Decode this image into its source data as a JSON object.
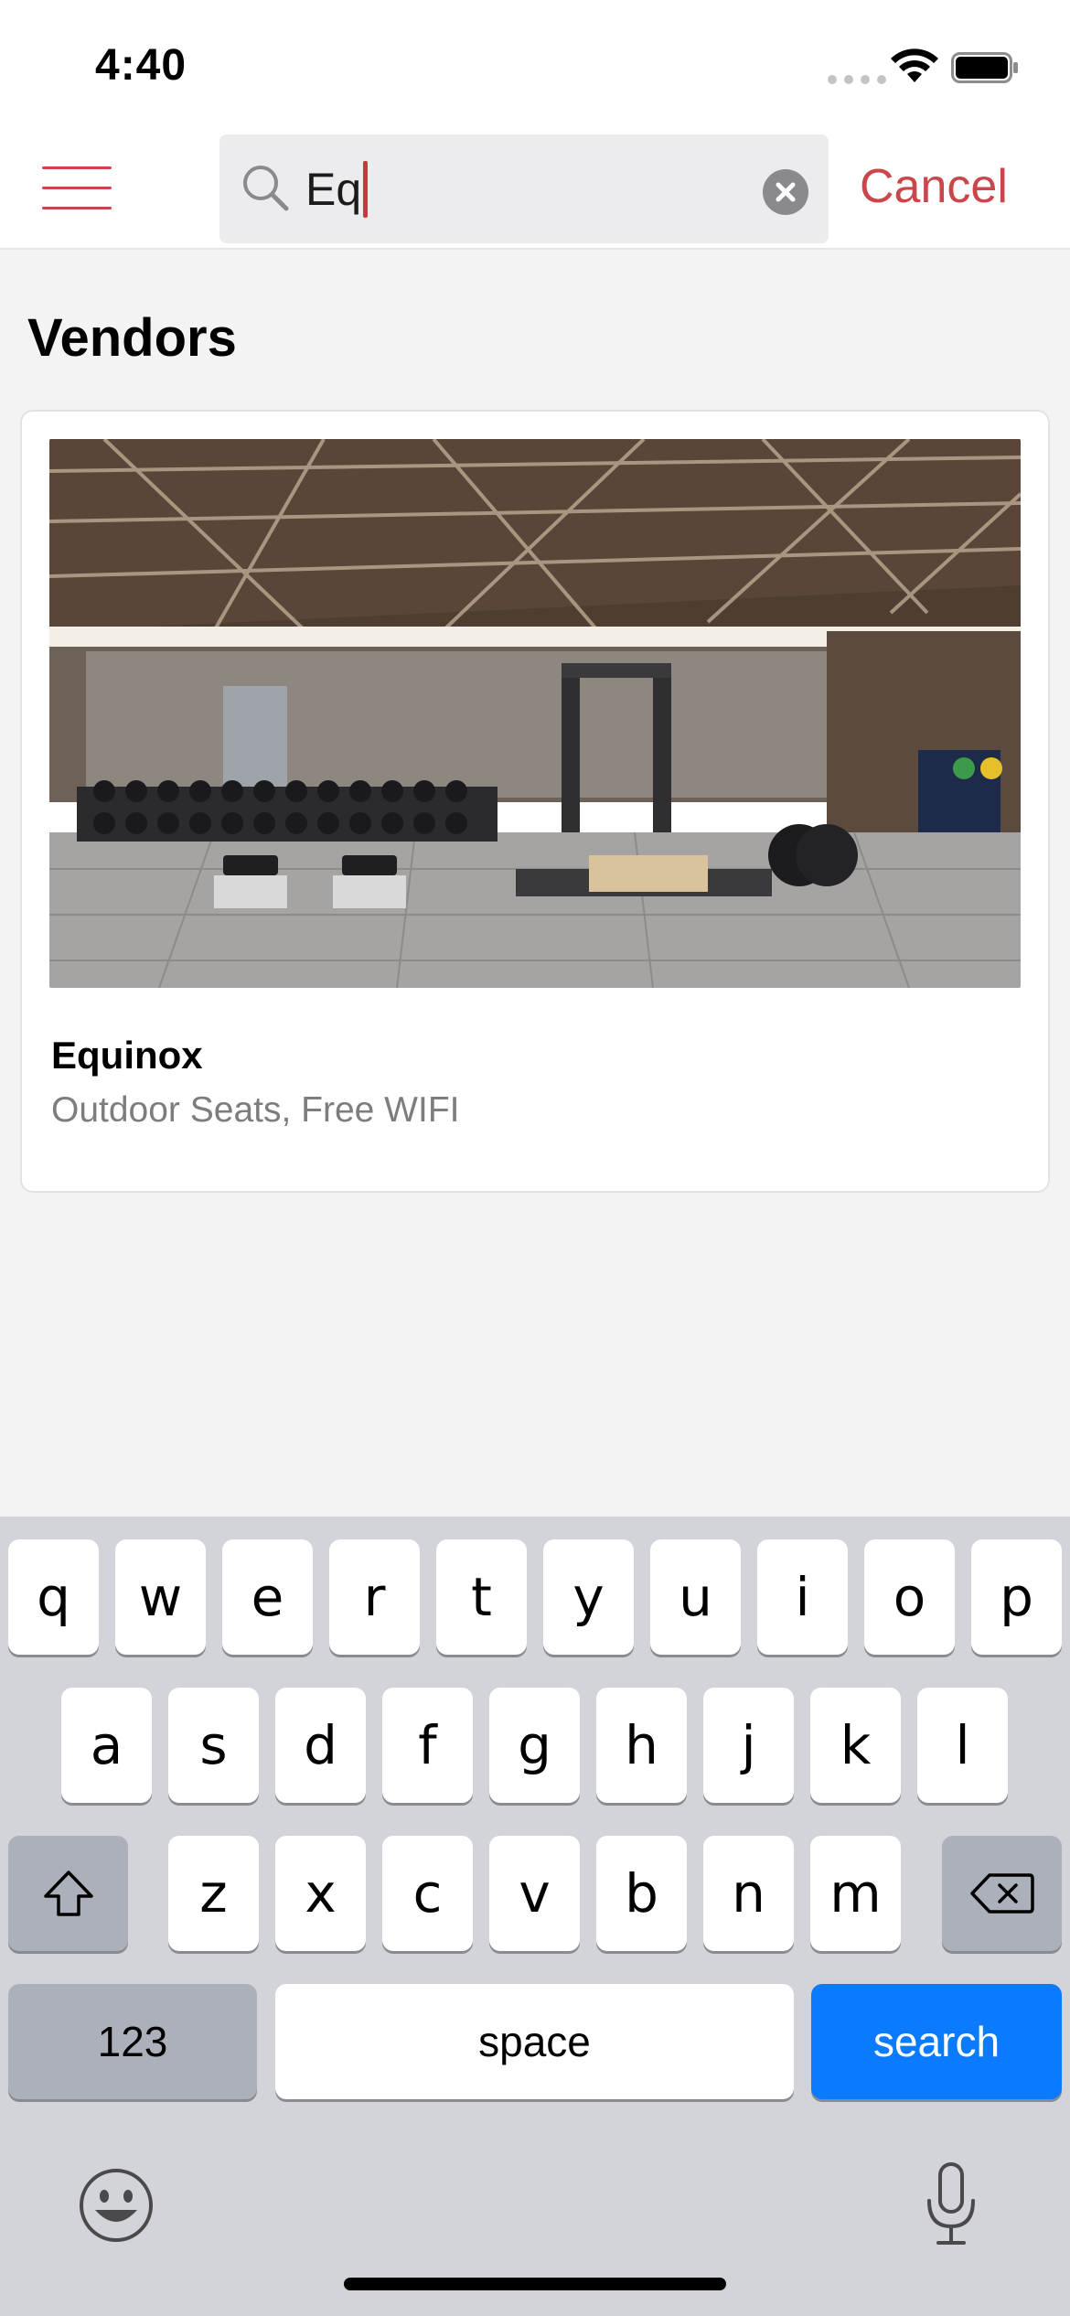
{
  "status_bar": {
    "time": "4:40"
  },
  "nav": {
    "search_value": "Eq",
    "cancel_label": "Cancel"
  },
  "section": {
    "title": "Vendors"
  },
  "vendors": [
    {
      "name": "Equinox",
      "tags": "Outdoor Seats, Free WIFI"
    }
  ],
  "keyboard": {
    "row1": [
      "q",
      "w",
      "e",
      "r",
      "t",
      "y",
      "u",
      "i",
      "o",
      "p"
    ],
    "row2": [
      "a",
      "s",
      "d",
      "f",
      "g",
      "h",
      "j",
      "k",
      "l"
    ],
    "row3": [
      "z",
      "x",
      "c",
      "v",
      "b",
      "n",
      "m"
    ],
    "numbers_label": "123",
    "space_label": "space",
    "search_label": "search"
  },
  "colors": {
    "accent": "#c9464b",
    "keyboard_action": "#0a7bff"
  },
  "icons": [
    "menu-icon",
    "search-icon",
    "clear-icon",
    "shift-icon",
    "backspace-icon",
    "emoji-icon",
    "microphone-icon",
    "wifi-icon",
    "battery-icon"
  ]
}
